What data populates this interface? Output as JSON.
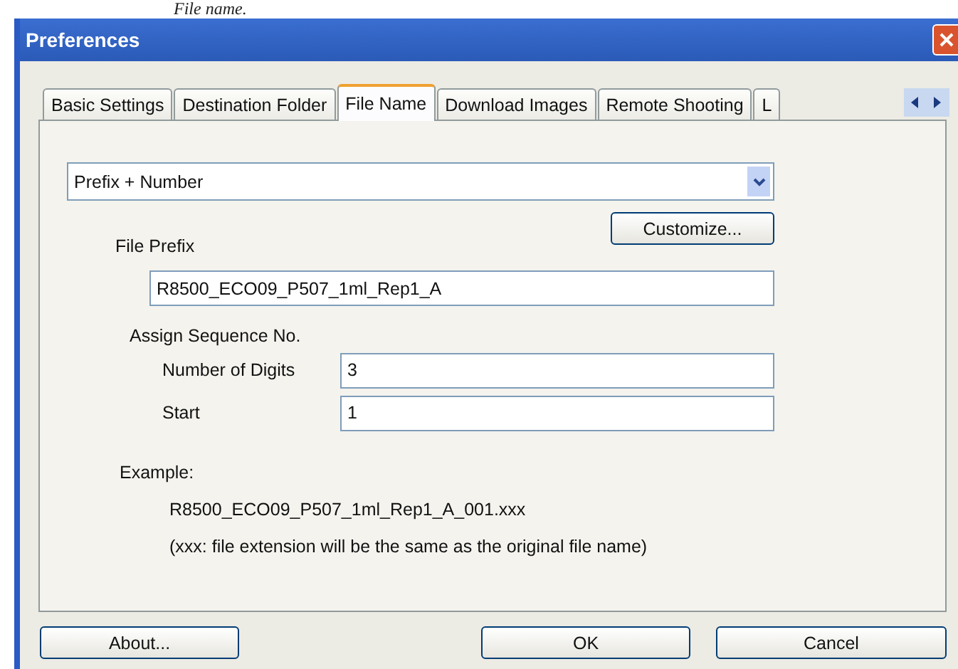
{
  "caption": "File name.",
  "window": {
    "title": "Preferences"
  },
  "tabs": [
    {
      "label": "Basic Settings",
      "selected": false
    },
    {
      "label": "Destination Folder",
      "selected": false
    },
    {
      "label": "File Name",
      "selected": true
    },
    {
      "label": "Download Images",
      "selected": false
    },
    {
      "label": "Remote Shooting",
      "selected": false
    },
    {
      "label": "L",
      "selected": false
    }
  ],
  "naming_dropdown": {
    "value": "Prefix + Number"
  },
  "customize_button": "Customize...",
  "file_prefix": {
    "label": "File Prefix",
    "value": "R8500_ECO09_P507_1ml_Rep1_A"
  },
  "sequence": {
    "title": "Assign Sequence No.",
    "fields": [
      {
        "label": "Number of Digits",
        "value": "3"
      },
      {
        "label": "Start",
        "value": "1"
      }
    ]
  },
  "example": {
    "label": "Example:",
    "value": "R8500_ECO09_P507_1ml_Rep1_A_001.xxx",
    "note": "(xxx: file extension will be the same as the original file name)"
  },
  "buttons": [
    "About...",
    "OK",
    "Cancel"
  ]
}
